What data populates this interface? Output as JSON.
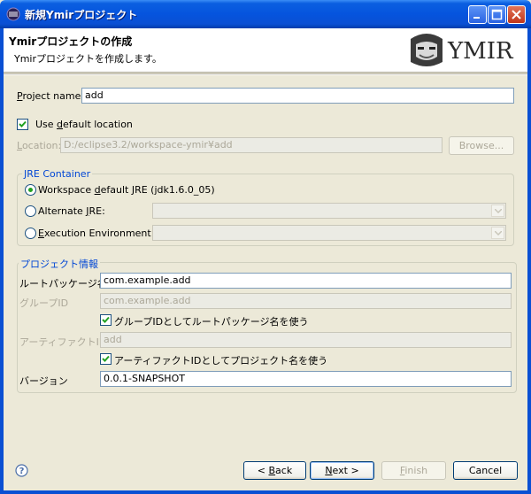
{
  "window": {
    "title": "新規Ymirプロジェクト",
    "close_icon": "close-icon",
    "minimize_icon": "minimize-icon",
    "maximize_icon": "maximize-icon"
  },
  "header": {
    "title": "Ymirプロジェクトの作成",
    "description": "Ymirプロジェクトを作成します。",
    "logo_text": "YMIR"
  },
  "project": {
    "name_label_mn": "P",
    "name_label_rest": "roject name:",
    "name_value": "add",
    "use_default_pre": "Use ",
    "use_default_mn": "d",
    "use_default_post": "efault location",
    "use_default_checked": true,
    "location_label_mn": "L",
    "location_label_rest": "ocation:",
    "location_value": "D:/eclipse3.2/workspace-ymir¥add",
    "browse_label": "Browse..."
  },
  "jre": {
    "group_title": "JRE Container",
    "workspace_pre": "Workspace ",
    "workspace_mn": "d",
    "workspace_post": "efault JRE (jdk1.6.0_05)",
    "alternate_pre": "Alternate ",
    "alternate_mn": "J",
    "alternate_post": "RE:",
    "execution_mn": "E",
    "execution_post": "xecution Environment:",
    "selected": "workspace"
  },
  "info": {
    "group_title": "プロジェクト情報",
    "root_package_label": "ルートパッケージ名",
    "root_package_value": "com.example.add",
    "group_id_label": "グループID",
    "group_id_value": "com.example.add",
    "use_root_as_group_label": "グループIDとしてルートパッケージ名を使う",
    "use_root_as_group_checked": true,
    "artifact_id_label": "アーティファクトID",
    "artifact_id_value": "add",
    "use_project_as_artifact_label": "アーティファクトIDとしてプロジェクト名を使う",
    "use_project_as_artifact_checked": true,
    "version_label": "バージョン",
    "version_value": "0.0.1-SNAPSHOT"
  },
  "footer": {
    "help_icon": "help-icon",
    "back_label_pre": "< ",
    "back_mn": "B",
    "back_post": "ack",
    "next_mn": "N",
    "next_post": "ext >",
    "finish_mn": "F",
    "finish_post": "inish",
    "cancel_label": "Cancel"
  },
  "colors": {
    "title_bar": "#0554de",
    "group_title": "#0046d5",
    "dialog_bg": "#ece9d8"
  }
}
